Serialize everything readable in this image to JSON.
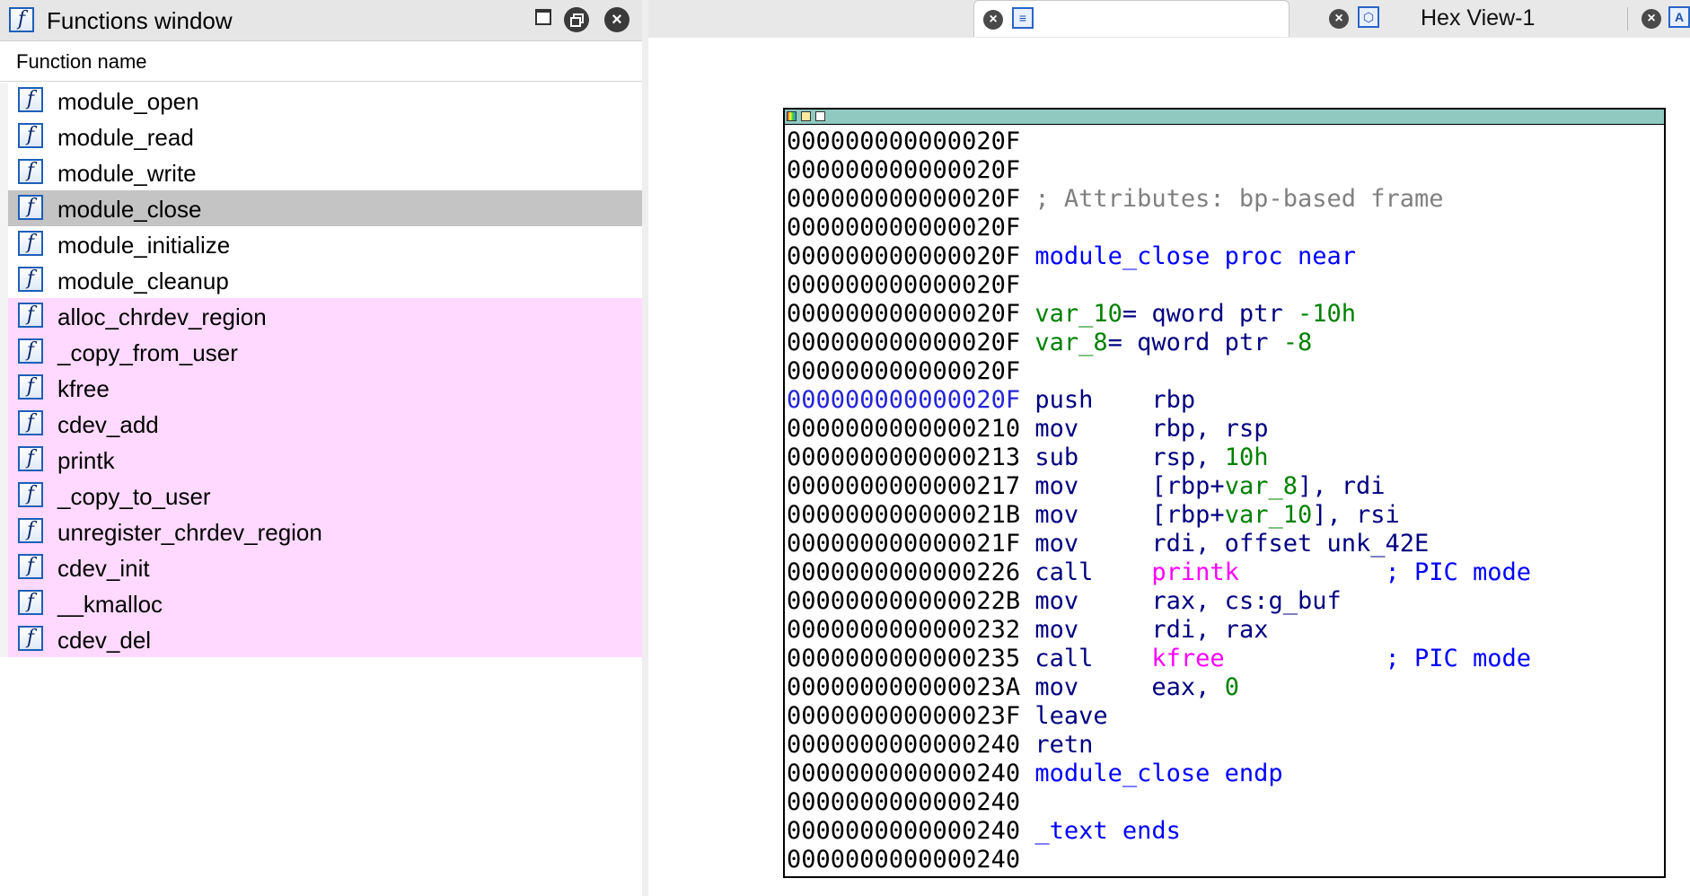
{
  "functions_window": {
    "title": "Functions window",
    "column_header": "Function name",
    "icon": "function-icon",
    "functions": [
      {
        "name": "module_open",
        "kind": "regular"
      },
      {
        "name": "module_read",
        "kind": "regular"
      },
      {
        "name": "module_write",
        "kind": "regular"
      },
      {
        "name": "module_close",
        "kind": "selected"
      },
      {
        "name": "module_initialize",
        "kind": "regular"
      },
      {
        "name": "module_cleanup",
        "kind": "regular"
      },
      {
        "name": "alloc_chrdev_region",
        "kind": "library"
      },
      {
        "name": "_copy_from_user",
        "kind": "library"
      },
      {
        "name": "kfree",
        "kind": "library"
      },
      {
        "name": "cdev_add",
        "kind": "library"
      },
      {
        "name": "printk",
        "kind": "library"
      },
      {
        "name": "_copy_to_user",
        "kind": "library"
      },
      {
        "name": "unregister_chrdev_region",
        "kind": "library"
      },
      {
        "name": "cdev_init",
        "kind": "library"
      },
      {
        "name": "__kmalloc",
        "kind": "library"
      },
      {
        "name": "cdev_del",
        "kind": "library"
      }
    ]
  },
  "tabs": {
    "ida_view": {
      "label": "",
      "icon": "ida-view-icon"
    },
    "hex_view": {
      "label": "Hex View-1",
      "icon": "hex-view-icon"
    },
    "structures": {
      "icon": "structures-icon"
    }
  },
  "colors": {
    "library_function_bg": "#ffd9ff",
    "selected_row_bg": "#c4c4c4",
    "node_header": "#8fc9c0",
    "comment": "#808080",
    "label": "#0000ff",
    "variable": "#008000",
    "function_ref": "#ff00ff"
  },
  "disassembly": {
    "lines": [
      {
        "addr": "000000000000020F",
        "parts": []
      },
      {
        "addr": "000000000000020F",
        "parts": []
      },
      {
        "addr": "000000000000020F",
        "parts": [
          {
            "t": " ; Attributes: bp-based frame",
            "c": "cmt"
          }
        ]
      },
      {
        "addr": "000000000000020F",
        "parts": []
      },
      {
        "addr": "000000000000020F",
        "parts": [
          {
            "t": " module_close proc near",
            "c": "lbl"
          }
        ]
      },
      {
        "addr": "000000000000020F",
        "parts": []
      },
      {
        "addr": "000000000000020F",
        "parts": [
          {
            "t": " var_10",
            "c": "var"
          },
          {
            "t": "= qword ptr ",
            "c": "kw"
          },
          {
            "t": "-10h",
            "c": "num"
          }
        ]
      },
      {
        "addr": "000000000000020F",
        "parts": [
          {
            "t": " var_8",
            "c": "var"
          },
          {
            "t": "= qword ptr ",
            "c": "kw"
          },
          {
            "t": "-8",
            "c": "num"
          }
        ]
      },
      {
        "addr": "000000000000020F",
        "parts": []
      },
      {
        "addr": "000000000000020F",
        "current": true,
        "parts": [
          {
            "t": " push    ",
            "c": "mn"
          },
          {
            "t": "rbp",
            "c": "reg"
          }
        ]
      },
      {
        "addr": "0000000000000210",
        "parts": [
          {
            "t": " mov     ",
            "c": "mn"
          },
          {
            "t": "rbp, rsp",
            "c": "reg"
          }
        ]
      },
      {
        "addr": "0000000000000213",
        "parts": [
          {
            "t": " sub     ",
            "c": "mn"
          },
          {
            "t": "rsp, ",
            "c": "reg"
          },
          {
            "t": "10h",
            "c": "num"
          }
        ]
      },
      {
        "addr": "0000000000000217",
        "parts": [
          {
            "t": " mov     ",
            "c": "mn"
          },
          {
            "t": "[rbp+",
            "c": "reg"
          },
          {
            "t": "var_8",
            "c": "var"
          },
          {
            "t": "], rdi",
            "c": "reg"
          }
        ]
      },
      {
        "addr": "000000000000021B",
        "parts": [
          {
            "t": " mov     ",
            "c": "mn"
          },
          {
            "t": "[rbp+",
            "c": "reg"
          },
          {
            "t": "var_10",
            "c": "var"
          },
          {
            "t": "], rsi",
            "c": "reg"
          }
        ]
      },
      {
        "addr": "000000000000021F",
        "parts": [
          {
            "t": " mov     ",
            "c": "mn"
          },
          {
            "t": "rdi, offset unk_42E",
            "c": "reg"
          }
        ]
      },
      {
        "addr": "0000000000000226",
        "parts": [
          {
            "t": " call    ",
            "c": "mn"
          },
          {
            "t": "printk",
            "c": "fnref"
          },
          {
            "t": "          ; PIC mode",
            "c": "pic"
          }
        ]
      },
      {
        "addr": "000000000000022B",
        "parts": [
          {
            "t": " mov     ",
            "c": "mn"
          },
          {
            "t": "rax, cs:g_buf",
            "c": "reg"
          }
        ]
      },
      {
        "addr": "0000000000000232",
        "parts": [
          {
            "t": " mov     ",
            "c": "mn"
          },
          {
            "t": "rdi, rax",
            "c": "reg"
          }
        ]
      },
      {
        "addr": "0000000000000235",
        "parts": [
          {
            "t": " call    ",
            "c": "mn"
          },
          {
            "t": "kfree",
            "c": "fnref"
          },
          {
            "t": "           ; PIC mode",
            "c": "pic"
          }
        ]
      },
      {
        "addr": "000000000000023A",
        "parts": [
          {
            "t": " mov     ",
            "c": "mn"
          },
          {
            "t": "eax, ",
            "c": "reg"
          },
          {
            "t": "0",
            "c": "num"
          }
        ]
      },
      {
        "addr": "000000000000023F",
        "parts": [
          {
            "t": " leave",
            "c": "mn"
          }
        ]
      },
      {
        "addr": "0000000000000240",
        "parts": [
          {
            "t": " retn",
            "c": "mn"
          }
        ]
      },
      {
        "addr": "0000000000000240",
        "parts": [
          {
            "t": " module_close endp",
            "c": "lbl"
          }
        ]
      },
      {
        "addr": "0000000000000240",
        "parts": []
      },
      {
        "addr": "0000000000000240",
        "parts": [
          {
            "t": " _text ends",
            "c": "lbl"
          }
        ]
      },
      {
        "addr": "0000000000000240",
        "parts": []
      }
    ]
  }
}
